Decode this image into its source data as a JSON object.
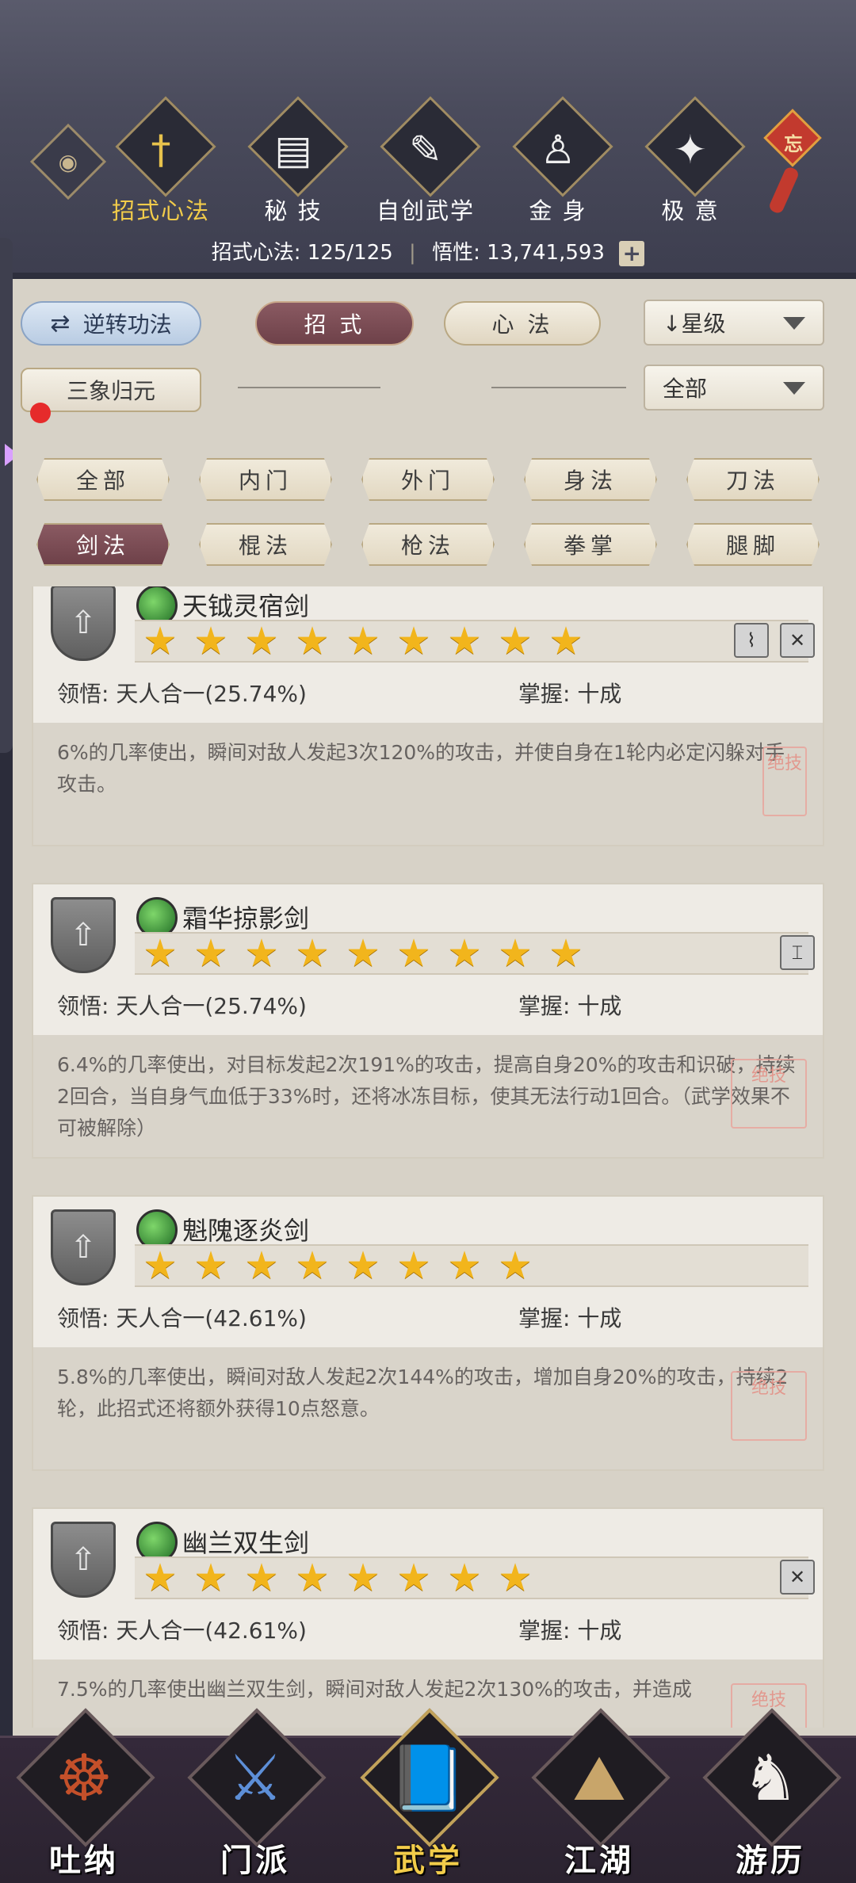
{
  "header": {
    "categories": [
      {
        "label": "招式心法",
        "icon": "sword-icon",
        "glyph": "†",
        "active": true
      },
      {
        "label": "秘 技",
        "icon": "book-icon",
        "glyph": "▤",
        "active": false
      },
      {
        "label": "自创武学",
        "icon": "scroll-icon",
        "glyph": "✎",
        "active": false
      },
      {
        "label": "金 身",
        "icon": "meditation-icon",
        "glyph": "♙",
        "active": false
      },
      {
        "label": "极 意",
        "icon": "martial-pose-icon",
        "glyph": "✦",
        "active": false
      }
    ],
    "knot_text": "忘",
    "stats": {
      "skills_label": "招式心法:",
      "skills_value": "125/125",
      "insight_label": "悟性:",
      "insight_value": "13,741,593"
    }
  },
  "filters": {
    "reverse_button": "逆转功法",
    "tab_moves": "招 式",
    "tab_mind": "心 法",
    "sort_dropdown": "↓星级",
    "three_elements_button": "三象归元",
    "scope_dropdown": "全部",
    "chips_row1": [
      "全部",
      "内门",
      "外门",
      "身法",
      "刀法"
    ],
    "chips_row2": [
      "剑法",
      "棍法",
      "枪法",
      "拳掌",
      "腿脚"
    ],
    "selected_chip": "剑法"
  },
  "skills": [
    {
      "name": "天钺灵宿剑",
      "stars": 9,
      "comprehension_label": "领悟:",
      "comprehension": "天人合一(25.74%)",
      "mastery_label": "掌握:",
      "mastery": "十成",
      "description": "6%的几率使出，瞬间对敌人发起3次120%的攻击，并使自身在1轮内必定闪躲对手攻击。",
      "seal": "绝技",
      "traits": [
        "trait-icon-a",
        "trait-icon-b"
      ]
    },
    {
      "name": "霜华掠影剑",
      "stars": 9,
      "comprehension_label": "领悟:",
      "comprehension": "天人合一(25.74%)",
      "mastery_label": "掌握:",
      "mastery": "十成",
      "description": "6.4%的几率使出，对目标发起2次191%的攻击，提高自身20%的攻击和识破，持续2回合，当自身气血低于33%时，还将冰冻目标，使其无法行动1回合。（武学效果不可被解除）",
      "seal": "绝技",
      "traits": [
        "trait-icon-c"
      ]
    },
    {
      "name": "魁隗逐炎剑",
      "stars": 8,
      "comprehension_label": "领悟:",
      "comprehension": "天人合一(42.61%)",
      "mastery_label": "掌握:",
      "mastery": "十成",
      "description": "5.8%的几率使出，瞬间对敌人发起2次144%的攻击，增加自身20%的攻击，持续2轮，此招式还将额外获得10点怒意。",
      "seal": "绝技",
      "traits": []
    },
    {
      "name": "幽兰双生剑",
      "stars": 8,
      "comprehension_label": "领悟:",
      "comprehension": "天人合一(42.61%)",
      "mastery_label": "掌握:",
      "mastery": "十成",
      "description": "7.5%的几率使出幽兰双生剑，瞬间对敌人发起2次130%的攻击，并造成",
      "seal": "绝技",
      "traits": [
        "trait-icon-b"
      ]
    }
  ],
  "bottom_nav": [
    {
      "label": "吐纳",
      "icon": "meditating-monk-icon",
      "glyph": "☸",
      "active": false
    },
    {
      "label": "门派",
      "icon": "sect-icon",
      "glyph": "⚔",
      "active": false
    },
    {
      "label": "武学",
      "icon": "martial-book-icon",
      "glyph": "📘",
      "active": true
    },
    {
      "label": "江湖",
      "icon": "straw-hat-icon",
      "glyph": "⛰",
      "active": false
    },
    {
      "label": "游历",
      "icon": "horse-icon",
      "glyph": "♞",
      "active": false
    }
  ]
}
